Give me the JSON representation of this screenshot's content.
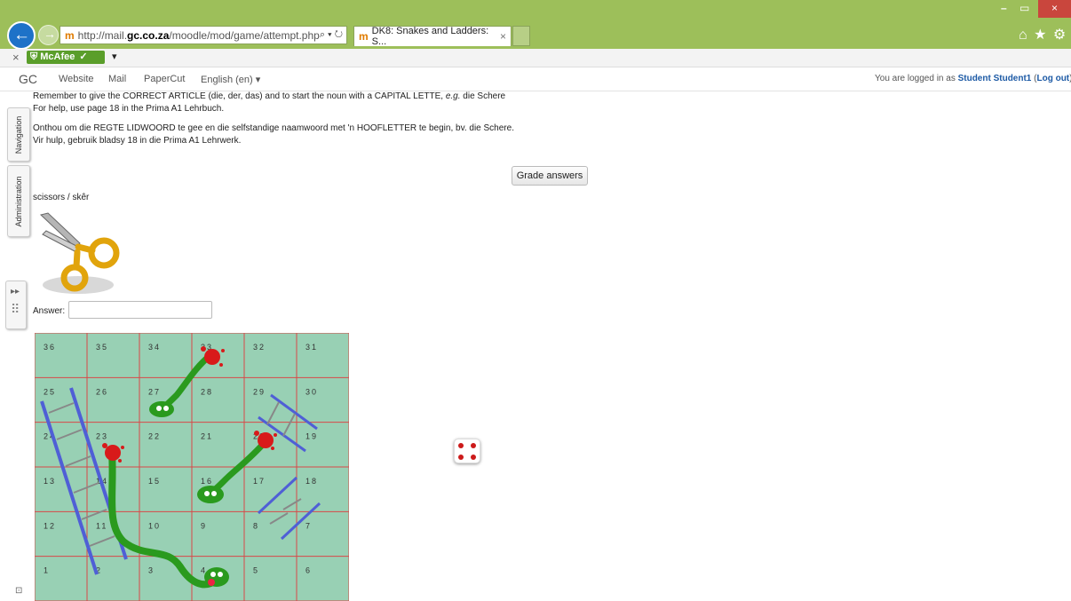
{
  "browser": {
    "url_prefix": "http://mail.",
    "url_domain": "gc.co.za",
    "url_path": "/moodle/mod/game/attempt.php",
    "search_glyph": "⌕ ▾ ↻",
    "tab_title": "DK8: Snakes and Ladders: S...",
    "tab_close": "×",
    "mcafee_label": "McAfee",
    "toolbar_close": "×",
    "toolbar_dropdown": "▾",
    "window_controls": [
      "–",
      "▭",
      "×"
    ],
    "right_icons": [
      "⌂",
      "★",
      "⚙"
    ]
  },
  "moodle_nav": {
    "logo": "GC",
    "links": [
      "Website",
      "Mail",
      "PaperCut",
      "English (en) ▾"
    ],
    "login_prefix": "You are logged in as ",
    "login_user": "Student Student1",
    "login_open": " (",
    "logout": "Log out",
    "login_close": ")"
  },
  "side_tabs": {
    "navigation": "Navigation",
    "administration": "Administration",
    "dock_arrows": "▸▸",
    "dock_grip": "⠿",
    "bottom_icon": "⊡"
  },
  "instructions": {
    "line1a": "Remember to give the CORRECT ARTICLE (die, der, das) and to start the noun with a CAPITAL LETTE, ",
    "line1b": "e.g.",
    "line1c": " die Schere",
    "line2": "For help, use page 18 in the Prima A1 Lehrbuch.",
    "line3": "Onthou om die REGTE LIDWOORD te gee en die selfstandige naamwoord met 'n HOOFLETTER te begin, bv. die Schere.",
    "line4": "Vir hulp, gebruik bladsy 18 in die Prima A1 Lehrwerk."
  },
  "grade_button": "Grade answers",
  "question": "scissors / skêr",
  "answer_label": "Answer:",
  "answer_value": "",
  "board": {
    "rows": [
      [
        "36",
        "35",
        "34",
        "33",
        "32",
        "31"
      ],
      [
        "25",
        "26",
        "27",
        "28",
        "29",
        "30"
      ],
      [
        "24",
        "23",
        "22",
        "21",
        "20",
        "19"
      ],
      [
        "13",
        "14",
        "15",
        "16",
        "17",
        "18"
      ],
      [
        "12",
        "11",
        "10",
        "9",
        "8",
        "7"
      ],
      [
        "1",
        "2",
        "3",
        "4",
        "5",
        "6"
      ]
    ],
    "colors": {
      "bg": "#98d0b4",
      "grid": "#d84848",
      "snake": "#2a9a1e",
      "ladder": "#4f5fd6",
      "splat": "#d81a1a"
    }
  },
  "dice_value": 4,
  "icons": [
    "back-icon",
    "forward-icon",
    "moodle-favicon",
    "search-icon",
    "refresh-icon",
    "home-icon",
    "star-icon",
    "gear-icon",
    "scissors-icon",
    "dice-icon"
  ]
}
